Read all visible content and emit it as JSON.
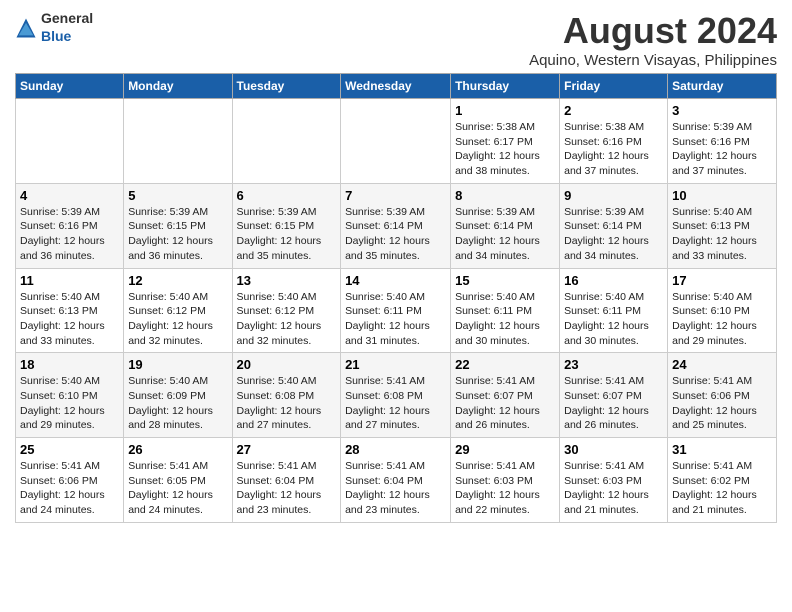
{
  "logo": {
    "text_general": "General",
    "text_blue": "Blue"
  },
  "title": "August 2024",
  "subtitle": "Aquino, Western Visayas, Philippines",
  "days_of_week": [
    "Sunday",
    "Monday",
    "Tuesday",
    "Wednesday",
    "Thursday",
    "Friday",
    "Saturday"
  ],
  "weeks": [
    [
      {
        "day": "",
        "info": ""
      },
      {
        "day": "",
        "info": ""
      },
      {
        "day": "",
        "info": ""
      },
      {
        "day": "",
        "info": ""
      },
      {
        "day": "1",
        "info": "Sunrise: 5:38 AM\nSunset: 6:17 PM\nDaylight: 12 hours\nand 38 minutes."
      },
      {
        "day": "2",
        "info": "Sunrise: 5:38 AM\nSunset: 6:16 PM\nDaylight: 12 hours\nand 37 minutes."
      },
      {
        "day": "3",
        "info": "Sunrise: 5:39 AM\nSunset: 6:16 PM\nDaylight: 12 hours\nand 37 minutes."
      }
    ],
    [
      {
        "day": "4",
        "info": "Sunrise: 5:39 AM\nSunset: 6:16 PM\nDaylight: 12 hours\nand 36 minutes."
      },
      {
        "day": "5",
        "info": "Sunrise: 5:39 AM\nSunset: 6:15 PM\nDaylight: 12 hours\nand 36 minutes."
      },
      {
        "day": "6",
        "info": "Sunrise: 5:39 AM\nSunset: 6:15 PM\nDaylight: 12 hours\nand 35 minutes."
      },
      {
        "day": "7",
        "info": "Sunrise: 5:39 AM\nSunset: 6:14 PM\nDaylight: 12 hours\nand 35 minutes."
      },
      {
        "day": "8",
        "info": "Sunrise: 5:39 AM\nSunset: 6:14 PM\nDaylight: 12 hours\nand 34 minutes."
      },
      {
        "day": "9",
        "info": "Sunrise: 5:39 AM\nSunset: 6:14 PM\nDaylight: 12 hours\nand 34 minutes."
      },
      {
        "day": "10",
        "info": "Sunrise: 5:40 AM\nSunset: 6:13 PM\nDaylight: 12 hours\nand 33 minutes."
      }
    ],
    [
      {
        "day": "11",
        "info": "Sunrise: 5:40 AM\nSunset: 6:13 PM\nDaylight: 12 hours\nand 33 minutes."
      },
      {
        "day": "12",
        "info": "Sunrise: 5:40 AM\nSunset: 6:12 PM\nDaylight: 12 hours\nand 32 minutes."
      },
      {
        "day": "13",
        "info": "Sunrise: 5:40 AM\nSunset: 6:12 PM\nDaylight: 12 hours\nand 32 minutes."
      },
      {
        "day": "14",
        "info": "Sunrise: 5:40 AM\nSunset: 6:11 PM\nDaylight: 12 hours\nand 31 minutes."
      },
      {
        "day": "15",
        "info": "Sunrise: 5:40 AM\nSunset: 6:11 PM\nDaylight: 12 hours\nand 30 minutes."
      },
      {
        "day": "16",
        "info": "Sunrise: 5:40 AM\nSunset: 6:11 PM\nDaylight: 12 hours\nand 30 minutes."
      },
      {
        "day": "17",
        "info": "Sunrise: 5:40 AM\nSunset: 6:10 PM\nDaylight: 12 hours\nand 29 minutes."
      }
    ],
    [
      {
        "day": "18",
        "info": "Sunrise: 5:40 AM\nSunset: 6:10 PM\nDaylight: 12 hours\nand 29 minutes."
      },
      {
        "day": "19",
        "info": "Sunrise: 5:40 AM\nSunset: 6:09 PM\nDaylight: 12 hours\nand 28 minutes."
      },
      {
        "day": "20",
        "info": "Sunrise: 5:40 AM\nSunset: 6:08 PM\nDaylight: 12 hours\nand 27 minutes."
      },
      {
        "day": "21",
        "info": "Sunrise: 5:41 AM\nSunset: 6:08 PM\nDaylight: 12 hours\nand 27 minutes."
      },
      {
        "day": "22",
        "info": "Sunrise: 5:41 AM\nSunset: 6:07 PM\nDaylight: 12 hours\nand 26 minutes."
      },
      {
        "day": "23",
        "info": "Sunrise: 5:41 AM\nSunset: 6:07 PM\nDaylight: 12 hours\nand 26 minutes."
      },
      {
        "day": "24",
        "info": "Sunrise: 5:41 AM\nSunset: 6:06 PM\nDaylight: 12 hours\nand 25 minutes."
      }
    ],
    [
      {
        "day": "25",
        "info": "Sunrise: 5:41 AM\nSunset: 6:06 PM\nDaylight: 12 hours\nand 24 minutes."
      },
      {
        "day": "26",
        "info": "Sunrise: 5:41 AM\nSunset: 6:05 PM\nDaylight: 12 hours\nand 24 minutes."
      },
      {
        "day": "27",
        "info": "Sunrise: 5:41 AM\nSunset: 6:04 PM\nDaylight: 12 hours\nand 23 minutes."
      },
      {
        "day": "28",
        "info": "Sunrise: 5:41 AM\nSunset: 6:04 PM\nDaylight: 12 hours\nand 23 minutes."
      },
      {
        "day": "29",
        "info": "Sunrise: 5:41 AM\nSunset: 6:03 PM\nDaylight: 12 hours\nand 22 minutes."
      },
      {
        "day": "30",
        "info": "Sunrise: 5:41 AM\nSunset: 6:03 PM\nDaylight: 12 hours\nand 21 minutes."
      },
      {
        "day": "31",
        "info": "Sunrise: 5:41 AM\nSunset: 6:02 PM\nDaylight: 12 hours\nand 21 minutes."
      }
    ]
  ]
}
